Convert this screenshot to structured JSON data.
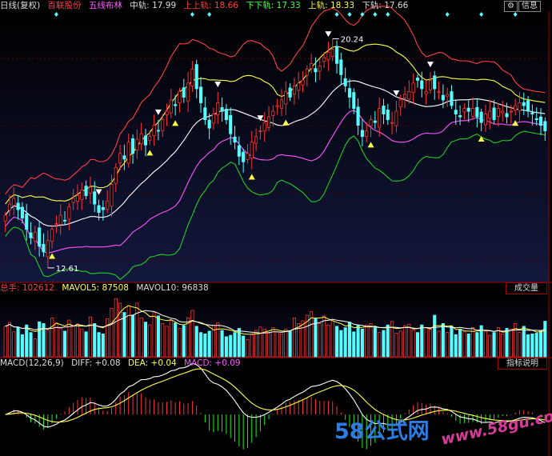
{
  "header": {
    "period": "日线(复权)",
    "stock": "百联股份",
    "indicator": "五线布林",
    "mid_label": "中轨: 17.99",
    "upper_label": "上上轨: 18.66",
    "lowerlower_label": "下下轨: 17.33",
    "up_label": "上轨: 18.33",
    "low_label": "下轨: 17.66",
    "btn_info": "信息"
  },
  "price_annotations": {
    "high": "20.24",
    "low": "12.61"
  },
  "volume_header": {
    "total": "总手: 102612",
    "mavol5": "MAVOL5: 87508",
    "mavol10": "MAVOL10: 96838",
    "button": "成交量"
  },
  "macd_header": {
    "title": "MACD(12,26,9)",
    "diff": "DIFF: +0.08",
    "dea": "DEA: +0.04",
    "macd": "MACD: +0.09",
    "button": "指标说明"
  },
  "watermark": {
    "brand": "58公式网",
    "url": "www.58gu.com"
  },
  "colors": {
    "up": "#ff3333",
    "down": "#55ffff",
    "mid": "#ffffff",
    "upper": "#ff4040",
    "uu": "#cc2222",
    "lower": "#ff55ff",
    "ll": "#22cc22",
    "yellow": "#ffff44"
  },
  "chart_data": {
    "type": "candlestick",
    "title": "百联股份 日线(复权) 五线布林",
    "price_range": [
      11.9,
      21.4
    ],
    "close": [
      14.2,
      14.6,
      14.8,
      14.4,
      14.1,
      13.7,
      13.4,
      13.6,
      13.1,
      12.9,
      13.3,
      13.7,
      13.9,
      14.2,
      14.0,
      14.5,
      14.8,
      14.9,
      15.1,
      14.9,
      15.2,
      14.6,
      14.3,
      14.4,
      14.7,
      15.3,
      15.9,
      16.4,
      16.2,
      16.8,
      16.4,
      16.9,
      17.1,
      16.7,
      17.0,
      17.4,
      17.2,
      17.6,
      17.9,
      18.3,
      18.1,
      18.6,
      18.4,
      18.9,
      19.4,
      18.7,
      18.2,
      17.6,
      17.3,
      17.8,
      18.2,
      17.9,
      17.6,
      17.1,
      16.8,
      16.3,
      16.1,
      16.4,
      16.8,
      17.0,
      17.2,
      17.5,
      17.7,
      17.9,
      18.1,
      18.3,
      18.6,
      18.4,
      18.8,
      18.9,
      19.0,
      19.4,
      19.6,
      19.3,
      19.5,
      19.8,
      20.0,
      20.1,
      19.6,
      19.2,
      18.8,
      18.4,
      18.0,
      17.4,
      17.0,
      17.2,
      17.6,
      17.5,
      18.0,
      17.8,
      17.6,
      17.5,
      17.9,
      18.3,
      18.5,
      18.6,
      18.9,
      19.0,
      18.7,
      18.6,
      19.0,
      18.7,
      18.6,
      18.3,
      18.5,
      18.1,
      17.8,
      17.7,
      18.0,
      17.9,
      18.0,
      17.7,
      17.5,
      17.8,
      17.9,
      17.6,
      18.0,
      17.9,
      17.7,
      17.9,
      18.1,
      18.2,
      18.1,
      17.9,
      17.8,
      17.6,
      17.4,
      17.2
    ],
    "volume": [
      88000,
      99000,
      72000,
      85000,
      64000,
      92000,
      70000,
      52000,
      101000,
      96000,
      78000,
      112000,
      98000,
      82000,
      74000,
      106000,
      88000,
      95000,
      80000,
      72000,
      115000,
      96000,
      70000,
      66000,
      110000,
      140000,
      168000,
      155000,
      128000,
      147000,
      120000,
      155000,
      112000,
      100000,
      92000,
      128000,
      118000,
      96000,
      88000,
      104000,
      98000,
      82000,
      90000,
      112000,
      134000,
      88000,
      70000,
      66000,
      74000,
      90000,
      98000,
      76000,
      58000,
      62000,
      70000,
      82000,
      60000,
      50000,
      64000,
      76000,
      86000,
      80000,
      68000,
      84000,
      72000,
      66000,
      80000,
      74000,
      112000,
      96000,
      104000,
      120000,
      130000,
      110000,
      96000,
      118000,
      92000,
      104000,
      88000,
      76000,
      84000,
      100000,
      72000,
      90000,
      80000,
      92000,
      96000,
      84000,
      70000,
      76000,
      92000,
      102000,
      68000,
      74000,
      90000,
      94000,
      78000,
      70000,
      92000,
      84000,
      80000,
      120000,
      74000,
      96000,
      70000,
      88000,
      64000,
      80000,
      72000,
      66000,
      84000,
      70000,
      90000,
      74000,
      62000,
      70000,
      84000,
      66000,
      82000,
      80000,
      96000,
      70000,
      88000,
      64000,
      66000,
      68000,
      76000,
      102612
    ],
    "volume_range": [
      0,
      180000
    ],
    "mavol5": 87508,
    "mavol10": 96838,
    "bollinger": {
      "mid": 17.99,
      "upper_upper": 18.66,
      "lower_lower": 17.33,
      "upper": 18.33,
      "lower": 17.66
    },
    "markers_up": [
      11,
      34,
      40,
      58,
      66,
      86,
      112,
      120
    ],
    "markers_down": [
      22,
      36,
      50,
      60,
      76,
      92,
      100
    ],
    "macd": {
      "diff": 0.08,
      "dea": 0.04,
      "macd": 0.09
    },
    "macd_range": [
      -0.8,
      0.9
    ]
  }
}
